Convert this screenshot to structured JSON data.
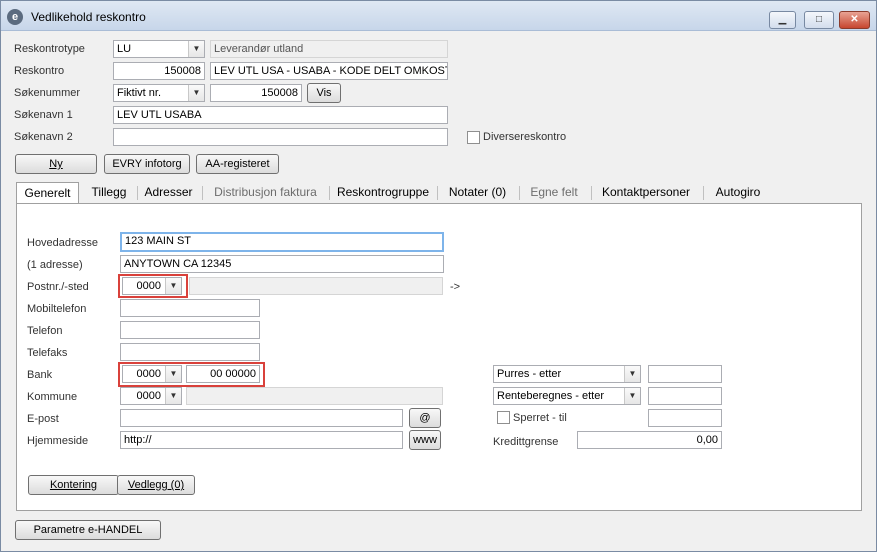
{
  "window": {
    "title": "Vedlikehold reskontro",
    "app_icon": "e"
  },
  "header": {
    "reskontrotype_label": "Reskontrotype",
    "reskontrotype_value": "LU",
    "reskontrotype_desc": "Leverandør utland",
    "reskontro_label": "Reskontro",
    "reskontro_value": "150008",
    "reskontro_name": "LEV UTL USA - USABA - KODE DELT OMKOSTN",
    "sokenummer_label": "Søkenummer",
    "sokenummer_type": "Fiktivt nr.",
    "sokenummer_value": "150008",
    "vis_button": "Vis",
    "sokenavn1_label": "Søkenavn 1",
    "sokenavn1_value": "LEV UTL USABA",
    "sokenavn2_label": "Søkenavn 2",
    "sokenavn2_value": "",
    "diverse_label": "Diversereskontro",
    "diverse_checked": false
  },
  "buttons": {
    "ny": "Ny",
    "evry": "EVRY infotorg",
    "aa": "AA-registeret",
    "kontering": "Kontering",
    "vedlegg": "Vedlegg (0)",
    "parametre": "Parametre e-HANDEL"
  },
  "tabs": [
    {
      "label": "Generelt",
      "active": true,
      "enabled": true
    },
    {
      "label": "Tillegg",
      "active": false,
      "enabled": true
    },
    {
      "label": "Adresser",
      "active": false,
      "enabled": true
    },
    {
      "label": "Distribusjon faktura",
      "active": false,
      "enabled": false
    },
    {
      "label": "Reskontrogruppe",
      "active": false,
      "enabled": true
    },
    {
      "label": "Notater (0)",
      "active": false,
      "enabled": true
    },
    {
      "label": "Egne felt",
      "active": false,
      "enabled": false
    },
    {
      "label": "Kontaktpersoner",
      "active": false,
      "enabled": true
    },
    {
      "label": "Autogiro",
      "active": false,
      "enabled": true
    }
  ],
  "general": {
    "hovedadresse_label": "Hovedadresse",
    "hovedadresse_value": "123 MAIN ST",
    "adresse1_label": "(1 adresse)",
    "adresse1_value": "ANYTOWN CA 12345",
    "postnr_label": "Postnr./-sted",
    "postnr_value": "0000",
    "poststed_value": "",
    "arrow": "->",
    "mobil_label": "Mobiltelefon",
    "mobil_value": "",
    "telefon_label": "Telefon",
    "telefon_value": "",
    "telefaks_label": "Telefaks",
    "telefaks_value": "",
    "bank_label": "Bank",
    "bank_code": "0000",
    "bank_account": "00 00000",
    "kommune_label": "Kommune",
    "kommune_value": "0000",
    "kommune_name": "",
    "epost_label": "E-post",
    "epost_value": "",
    "at_button": "@",
    "hjemmeside_label": "Hjemmeside",
    "hjemmeside_value": "http://",
    "www_button": "www",
    "purres_option": "Purres - etter",
    "purres_value": "",
    "rente_option": "Renteberegnes - etter",
    "rente_value": "",
    "sperret_label": "Sperret  -  til",
    "sperret_checked": false,
    "sperret_value": "",
    "kredittgrense_label": "Kredittgrense",
    "kredittgrense_value": "0,00"
  },
  "colors": {
    "highlight": "#d9413b",
    "focus": "#7eb4ea",
    "background": "#f0f0f0"
  }
}
